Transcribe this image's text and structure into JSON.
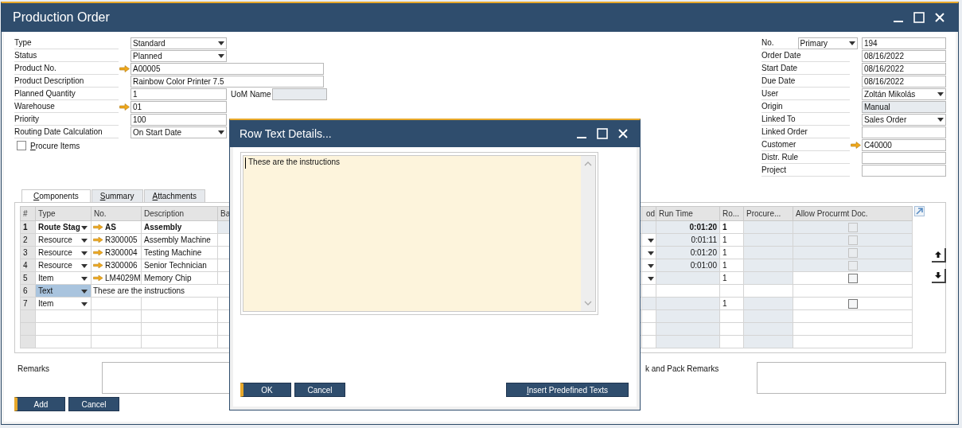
{
  "window": {
    "title": "Production Order"
  },
  "header_left": [
    {
      "label": "Type",
      "kind": "dropdown",
      "value": "Standard"
    },
    {
      "label": "Status",
      "kind": "dropdown",
      "value": "Planned"
    },
    {
      "label": "Product No.",
      "kind": "link",
      "value": "A00005"
    },
    {
      "label": "Product Description",
      "kind": "text",
      "value": "Rainbow Color Printer 7.5"
    },
    {
      "label": "Planned Quantity",
      "kind": "text",
      "value": "1",
      "extra_label": "UoM Name"
    },
    {
      "label": "Warehouse",
      "kind": "link",
      "value": "01"
    },
    {
      "label": "Priority",
      "kind": "text",
      "value": "100"
    },
    {
      "label": "Routing Date Calculation",
      "kind": "dropdown",
      "value": "On Start Date"
    }
  ],
  "procure_items": {
    "label": "Procure Items",
    "checked": false
  },
  "header_right": [
    {
      "label": "No.",
      "kind": "series",
      "series": "Primary",
      "value": "194"
    },
    {
      "label": "Order Date",
      "kind": "text",
      "value": "08/16/2022"
    },
    {
      "label": "Start Date",
      "kind": "text",
      "value": "08/16/2022"
    },
    {
      "label": "Due Date",
      "kind": "text",
      "value": "08/16/2022"
    },
    {
      "label": "User",
      "kind": "dropdown",
      "value": "Zoltán Mikolás"
    },
    {
      "label": "Origin",
      "kind": "readonly",
      "value": "Manual"
    },
    {
      "label": "Linked To",
      "kind": "dropdown",
      "value": "Sales Order"
    },
    {
      "label": "Linked Order",
      "kind": "text"
    },
    {
      "label": "Customer",
      "kind": "link",
      "value": "C40000"
    },
    {
      "label": "Distr. Rule",
      "kind": "text"
    },
    {
      "label": "Project",
      "kind": "text"
    }
  ],
  "tabs": [
    {
      "label": "Components",
      "selected": true
    },
    {
      "label": "Summary",
      "selected": false
    },
    {
      "label": "Attachments",
      "selected": false
    }
  ],
  "table": {
    "columns": [
      "#",
      "Type",
      "No.",
      "Description",
      "Ba",
      "od",
      "Run Time",
      "Ro...",
      "Procure...",
      "Allow Procurmt Doc."
    ],
    "rows": [
      {
        "num": "1",
        "kind": "route_stage",
        "type": "Route Stag",
        "no": "AS",
        "description": "Assembly",
        "run_time": "0:01:20",
        "ro": "1",
        "selected": false,
        "allow_checked": false,
        "allow_disabled": true
      },
      {
        "num": "2",
        "kind": "resource",
        "type": "Resource",
        "no": "R300005",
        "description": "Assembly Machine",
        "run_time": "0:01:11",
        "ro": "1",
        "selected": false,
        "allow_checked": false,
        "allow_disabled": true
      },
      {
        "num": "3",
        "kind": "resource",
        "type": "Resource",
        "no": "R300004",
        "description": "Testing Machine",
        "run_time": "0:01:20",
        "ro": "1",
        "selected": false,
        "allow_checked": false,
        "allow_disabled": true
      },
      {
        "num": "4",
        "kind": "resource",
        "type": "Resource",
        "no": "R300006",
        "description": "Senior Technician",
        "run_time": "0:01:00",
        "ro": "1",
        "selected": false,
        "allow_checked": false,
        "allow_disabled": true
      },
      {
        "num": "5",
        "kind": "item",
        "type": "Item",
        "no": "LM4029M",
        "description": "Memory Chip",
        "ro": "1",
        "selected": false,
        "allow_checked": false,
        "allow_disabled": false
      },
      {
        "num": "6",
        "kind": "text",
        "type": "Text",
        "text": "These are the instructions",
        "selected": true
      },
      {
        "num": "7",
        "kind": "item",
        "type": "Item",
        "ro": "1",
        "selected": false,
        "allow_checked": false,
        "allow_disabled": false
      }
    ]
  },
  "remarks": {
    "label": "Remarks"
  },
  "pack_remarks": {
    "label": "k and Pack Remarks"
  },
  "buttons": [
    "Add",
    "Cancel"
  ],
  "dialog": {
    "title": "Row Text Details...",
    "text": "These are the instructions",
    "buttons": [
      "OK",
      "Cancel"
    ],
    "insert_button": "Insert Predefined Texts"
  }
}
